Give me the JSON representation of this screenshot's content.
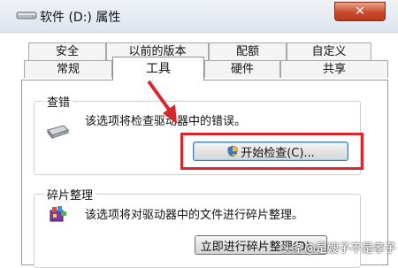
{
  "window": {
    "title": "软件 (D:) 属性",
    "close_label": "✕"
  },
  "tabs": {
    "row1": [
      "安全",
      "以前的版本",
      "配额",
      "自定义"
    ],
    "row2": [
      "常规",
      "工具",
      "硬件",
      "共享"
    ],
    "active": "工具"
  },
  "error_check": {
    "group_label": "查错",
    "description": "该选项将检查驱动器中的错误。",
    "button_label": "开始检查(C)...",
    "icon": "drive-icon"
  },
  "defrag": {
    "group_label": "碎片整理",
    "description": "该选项将对驱动器中的文件进行碎片整理。",
    "button_label": "立即进行碎片整理(D)...",
    "icon": "defrag-icon"
  },
  "annotation": {
    "highlight_color": "#d9262a",
    "watermark": "头条@是嫂子不是孝子"
  }
}
